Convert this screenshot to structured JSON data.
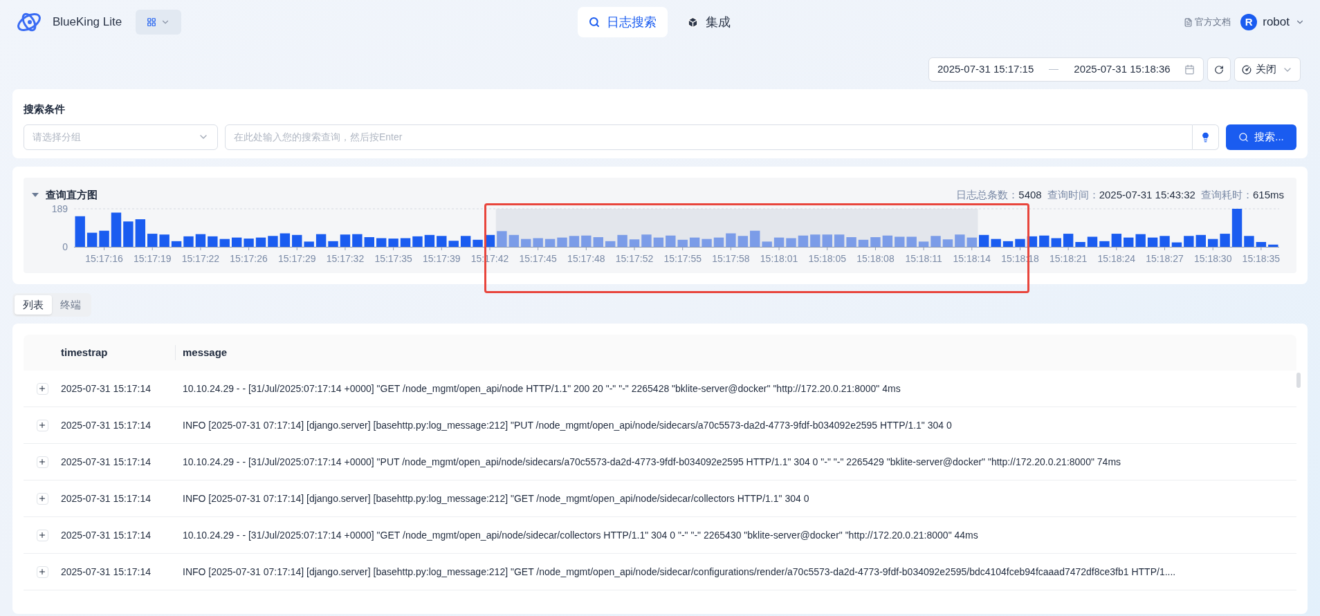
{
  "header": {
    "brand": "BlueKing Lite",
    "nav": [
      {
        "label": "日志搜索",
        "selected": true
      },
      {
        "label": "集成",
        "selected": false
      }
    ],
    "docs_link": "官方文档",
    "user": {
      "initial": "R",
      "name": "robot"
    }
  },
  "time_range": {
    "start": "2025-07-31 15:17:15",
    "end": "2025-07-31 15:18:36"
  },
  "refresh_select": {
    "value": "关闭"
  },
  "search": {
    "title": "搜索条件",
    "group_select": {
      "placeholder": "请选择分组"
    },
    "query": {
      "placeholder": "在此处输入您的搜索查询，然后按Enter"
    },
    "button": "搜索..."
  },
  "histogram": {
    "title": "查询直方图",
    "expanded": true,
    "stats": [
      {
        "label": "日志总条数：",
        "value": "5408"
      },
      {
        "label": "查询时间：",
        "value": "2025-07-31 15:43:32"
      },
      {
        "label": "查询耗时：",
        "value": "615ms"
      }
    ],
    "chart_data": {
      "type": "bar",
      "ylim": [
        0,
        189
      ],
      "yticks": [
        0,
        189
      ],
      "categories": [
        null,
        null,
        "15:17:16",
        null,
        null,
        null,
        "15:17:19",
        null,
        null,
        null,
        "15:17:22",
        null,
        null,
        null,
        "15:17:26",
        null,
        null,
        null,
        "15:17:29",
        null,
        null,
        null,
        "15:17:32",
        null,
        null,
        null,
        "15:17:35",
        null,
        null,
        null,
        "15:17:39",
        null,
        null,
        null,
        "15:17:42",
        null,
        null,
        null,
        "15:17:45",
        null,
        null,
        null,
        "15:17:48",
        null,
        null,
        null,
        "15:17:52",
        null,
        null,
        null,
        "15:17:55",
        null,
        null,
        null,
        "15:17:58",
        null,
        null,
        null,
        "15:18:01",
        null,
        null,
        null,
        "15:18:05",
        null,
        null,
        null,
        "15:18:08",
        null,
        null,
        null,
        "15:18:11",
        null,
        null,
        null,
        "15:18:14",
        null,
        null,
        null,
        "15:18:18",
        null,
        null,
        null,
        "15:18:21",
        null,
        null,
        null,
        "15:18:24",
        null,
        null,
        null,
        "15:18:27",
        null,
        null,
        null,
        "15:18:30",
        null,
        null,
        null,
        "15:18:35",
        null
      ],
      "stacked": true,
      "series": [
        {
          "color": "#1a5cf0",
          "values": [
            152,
            70,
            80,
            170,
            126,
            137,
            65,
            61,
            28,
            52,
            63,
            52,
            39,
            46,
            41,
            46,
            54,
            67,
            59,
            26,
            63,
            28,
            61,
            63,
            48,
            43,
            41,
            43,
            52,
            59,
            54,
            30,
            54,
            35,
            59,
            null,
            null,
            null,
            null,
            null,
            null,
            null,
            null,
            null,
            null,
            null,
            null,
            null,
            null,
            null,
            null,
            null,
            null,
            null,
            null,
            null,
            null,
            null,
            null,
            null,
            null,
            null,
            null,
            null,
            null,
            null,
            null,
            null,
            null,
            null,
            null,
            null,
            null,
            null,
            null,
            59,
            39,
            28,
            39,
            52,
            56,
            43,
            65,
            24,
            50,
            28,
            65,
            46,
            63,
            46,
            54,
            22,
            54,
            59,
            39,
            65,
            189,
            54,
            24,
            11
          ]
        },
        {
          "color": "#7b9ce8",
          "values": [
            null,
            null,
            null,
            null,
            null,
            null,
            null,
            null,
            null,
            null,
            null,
            null,
            null,
            null,
            null,
            null,
            null,
            null,
            null,
            null,
            null,
            null,
            null,
            null,
            null,
            null,
            null,
            null,
            null,
            null,
            null,
            null,
            null,
            null,
            null,
            78,
            59,
            39,
            43,
            39,
            46,
            54,
            56,
            48,
            28,
            59,
            37,
            61,
            46,
            56,
            35,
            46,
            39,
            46,
            67,
            54,
            80,
            26,
            46,
            43,
            56,
            61,
            61,
            61,
            48,
            35,
            48,
            56,
            50,
            50,
            26,
            54,
            37,
            61,
            46,
            null,
            null,
            null,
            null,
            null,
            null,
            null,
            null,
            null,
            null,
            null,
            null,
            null,
            null,
            null,
            null,
            null,
            null,
            null,
            null,
            null,
            null,
            null,
            null,
            null
          ]
        }
      ]
    }
  },
  "view_tabs": [
    {
      "label": "列表",
      "selected": true
    },
    {
      "label": "终端",
      "selected": false
    }
  ],
  "table": {
    "columns": [
      "timestrap",
      "message"
    ],
    "rows": [
      {
        "timestamp": "2025-07-31 15:17:14",
        "message": "10.10.24.29 - - [31/Jul/2025:07:17:14 +0000] \"GET /node_mgmt/open_api/node HTTP/1.1\" 200 20 \"-\" \"-\" 2265428 \"bklite-server@docker\" \"http://172.20.0.21:8000\" 4ms"
      },
      {
        "timestamp": "2025-07-31 15:17:14",
        "message": "INFO [2025-07-31 07:17:14] [django.server] [basehttp.py:log_message:212] \"PUT /node_mgmt/open_api/node/sidecars/a70c5573-da2d-4773-9fdf-b034092e2595 HTTP/1.1\" 304 0"
      },
      {
        "timestamp": "2025-07-31 15:17:14",
        "message": "10.10.24.29 - - [31/Jul/2025:07:17:14 +0000] \"PUT /node_mgmt/open_api/node/sidecars/a70c5573-da2d-4773-9fdf-b034092e2595 HTTP/1.1\" 304 0 \"-\" \"-\" 2265429 \"bklite-server@docker\" \"http://172.20.0.21:8000\" 74ms"
      },
      {
        "timestamp": "2025-07-31 15:17:14",
        "message": "INFO [2025-07-31 07:17:14] [django.server] [basehttp.py:log_message:212] \"GET /node_mgmt/open_api/node/sidecar/collectors HTTP/1.1\" 304 0"
      },
      {
        "timestamp": "2025-07-31 15:17:14",
        "message": "10.10.24.29 - - [31/Jul/2025:07:17:14 +0000] \"GET /node_mgmt/open_api/node/sidecar/collectors HTTP/1.1\" 304 0 \"-\" \"-\" 2265430 \"bklite-server@docker\" \"http://172.20.0.21:8000\" 44ms"
      },
      {
        "timestamp": "2025-07-31 15:17:14",
        "message": "INFO [2025-07-31 07:17:14] [django.server] [basehttp.py:log_message:212] \"GET /node_mgmt/open_api/node/sidecar/configurations/render/a70c5573-da2d-4773-9fdf-b034092e2595/bdc4104fceb94fcaaad7472df8ce3fb1 HTTP/1...."
      }
    ]
  }
}
